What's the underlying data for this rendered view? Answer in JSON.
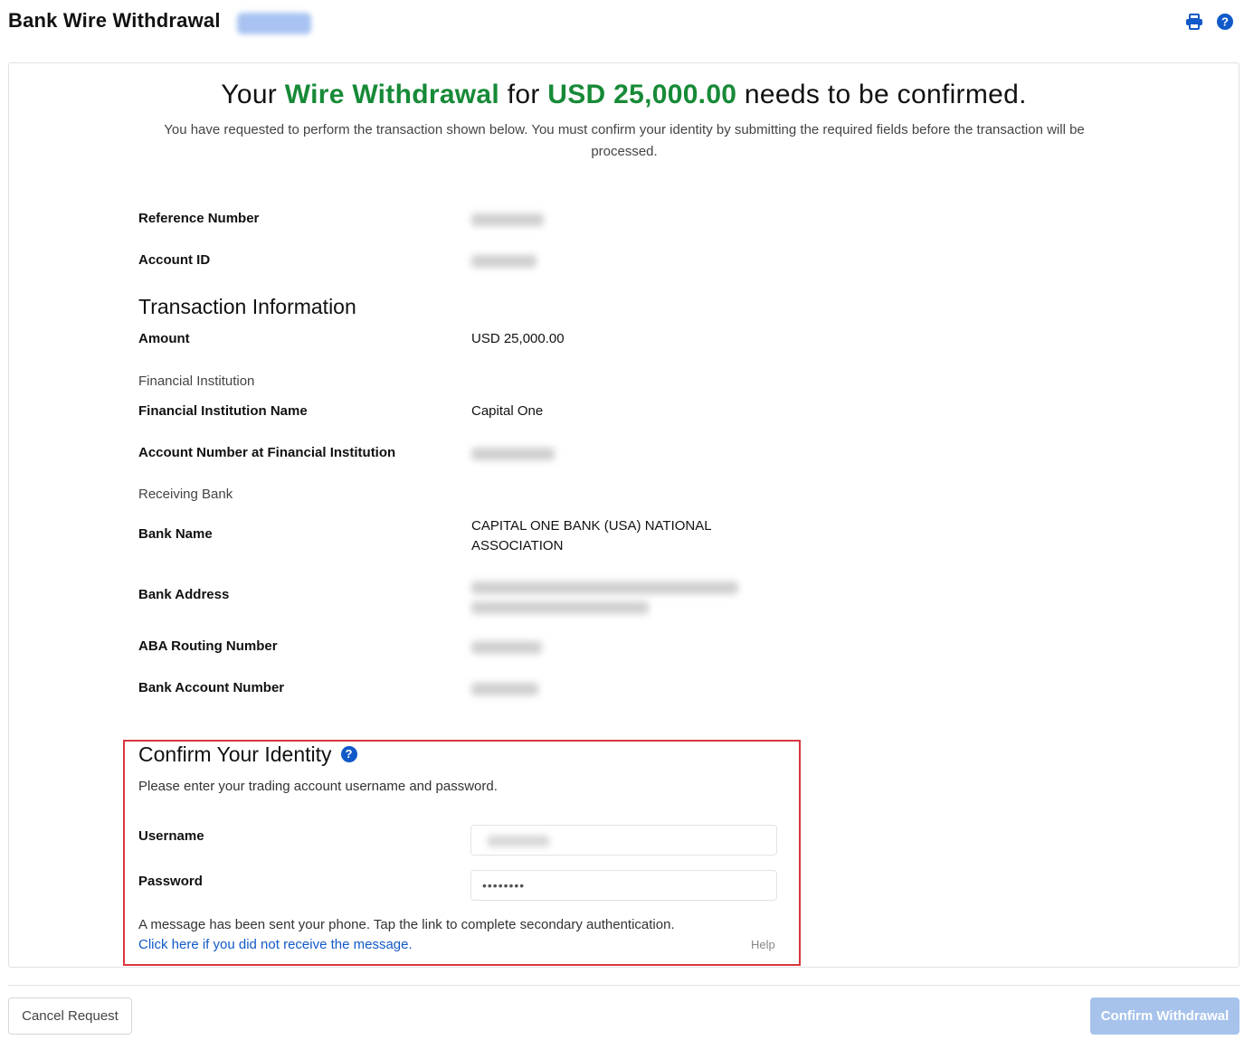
{
  "header": {
    "title": "Bank Wire Withdrawal",
    "print_icon": "printer-icon",
    "help_icon": "question-circle-icon"
  },
  "notice": {
    "headline_prefix": "Your ",
    "headline_type": "Wire Withdrawal",
    "headline_mid": " for ",
    "headline_amount": "USD 25,000.00",
    "headline_suffix": " needs to be confirmed.",
    "description": "You have requested to perform the transaction shown below. You must confirm your identity by submitting the required fields before the transaction will be processed."
  },
  "details": {
    "reference_label": "Reference Number",
    "account_id_label": "Account ID"
  },
  "transaction": {
    "section_title": "Transaction Information",
    "amount_label": "Amount",
    "amount_value": "USD 25,000.00",
    "fi_heading": "Financial Institution",
    "fi_name_label": "Financial Institution Name",
    "fi_name_value": "Capital One",
    "fi_account_label": "Account Number at Financial Institution",
    "receiving_heading": "Receiving Bank",
    "bank_name_label": "Bank Name",
    "bank_name_line1": "CAPITAL ONE BANK (USA) NATIONAL",
    "bank_name_line2": "ASSOCIATION",
    "bank_address_label": "Bank Address",
    "aba_label": "ABA Routing Number",
    "bank_account_label": "Bank Account Number"
  },
  "identity": {
    "title": "Confirm Your Identity",
    "help_glyph": "?",
    "instructions": "Please enter your trading account username and password.",
    "username_label": "Username",
    "password_label": "Password",
    "password_value": "••••••••",
    "message": "A message has been sent your phone. Tap the link to complete secondary authentication.",
    "resend_link": "Click here if you did not receive the message.",
    "help_link": "Help"
  },
  "footer": {
    "cancel_label": "Cancel Request",
    "confirm_label": "Confirm Withdrawal"
  },
  "colors": {
    "accent_green": "#178a37",
    "link_blue": "#1159c8",
    "highlight_red": "#d9363e",
    "confirm_disabled": "#a7c3ec"
  }
}
